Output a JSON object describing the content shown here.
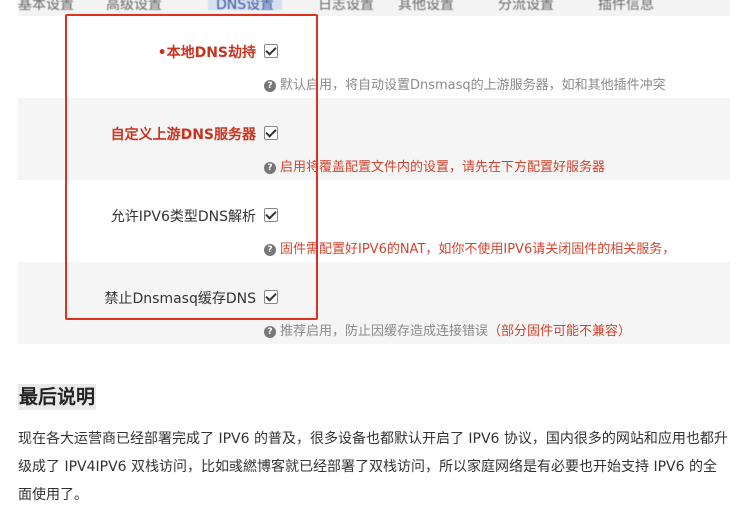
{
  "screenshot": {
    "tabs": [
      {
        "label": "基本设置"
      },
      {
        "label": "高级设置"
      },
      {
        "label": "DNS设置",
        "active": true
      },
      {
        "label": "日志设置"
      },
      {
        "label": "其他设置"
      },
      {
        "label": "分流设置"
      },
      {
        "label": "插件信息"
      }
    ],
    "settings": [
      {
        "label": "•本地DNS劫持",
        "checked": true,
        "help": "默认启用，将自动设置Dnsmasq的上游服务器，如和其他插件冲突"
      },
      {
        "label": "自定义上游DNS服务器",
        "checked": true,
        "help": "启用将覆盖配置文件内的设置，请先在下方配置好服务器"
      },
      {
        "label": "允许IPV6类型DNS解析",
        "checked": true,
        "help": "固件需配置好IPV6的NAT，如你不使用IPV6请关闭固件的相关服务，"
      },
      {
        "label": "禁止Dnsmasq缓存DNS",
        "checked": true,
        "help": "推荐启用，防止因缓存造成连接错误",
        "help_suffix": "（部分固件可能不兼容）"
      }
    ]
  },
  "article": {
    "heading": "最后说明",
    "paragraph": "现在各大运营商已经部署完成了 IPV6 的普及，很多设备也都默认开启了 IPV6 协议，国内很多的网站和应用也都升级成了 IPV4IPV6 双栈访问，比如彧繎博客就已经部署了双栈访问，所以家庭网络是有必要也开始支持 IPV6 的全面使用了。"
  },
  "colors": {
    "highlight_border": "#e0301e",
    "red_label": "#c9331f",
    "help_gray": "#8a8a8a"
  }
}
